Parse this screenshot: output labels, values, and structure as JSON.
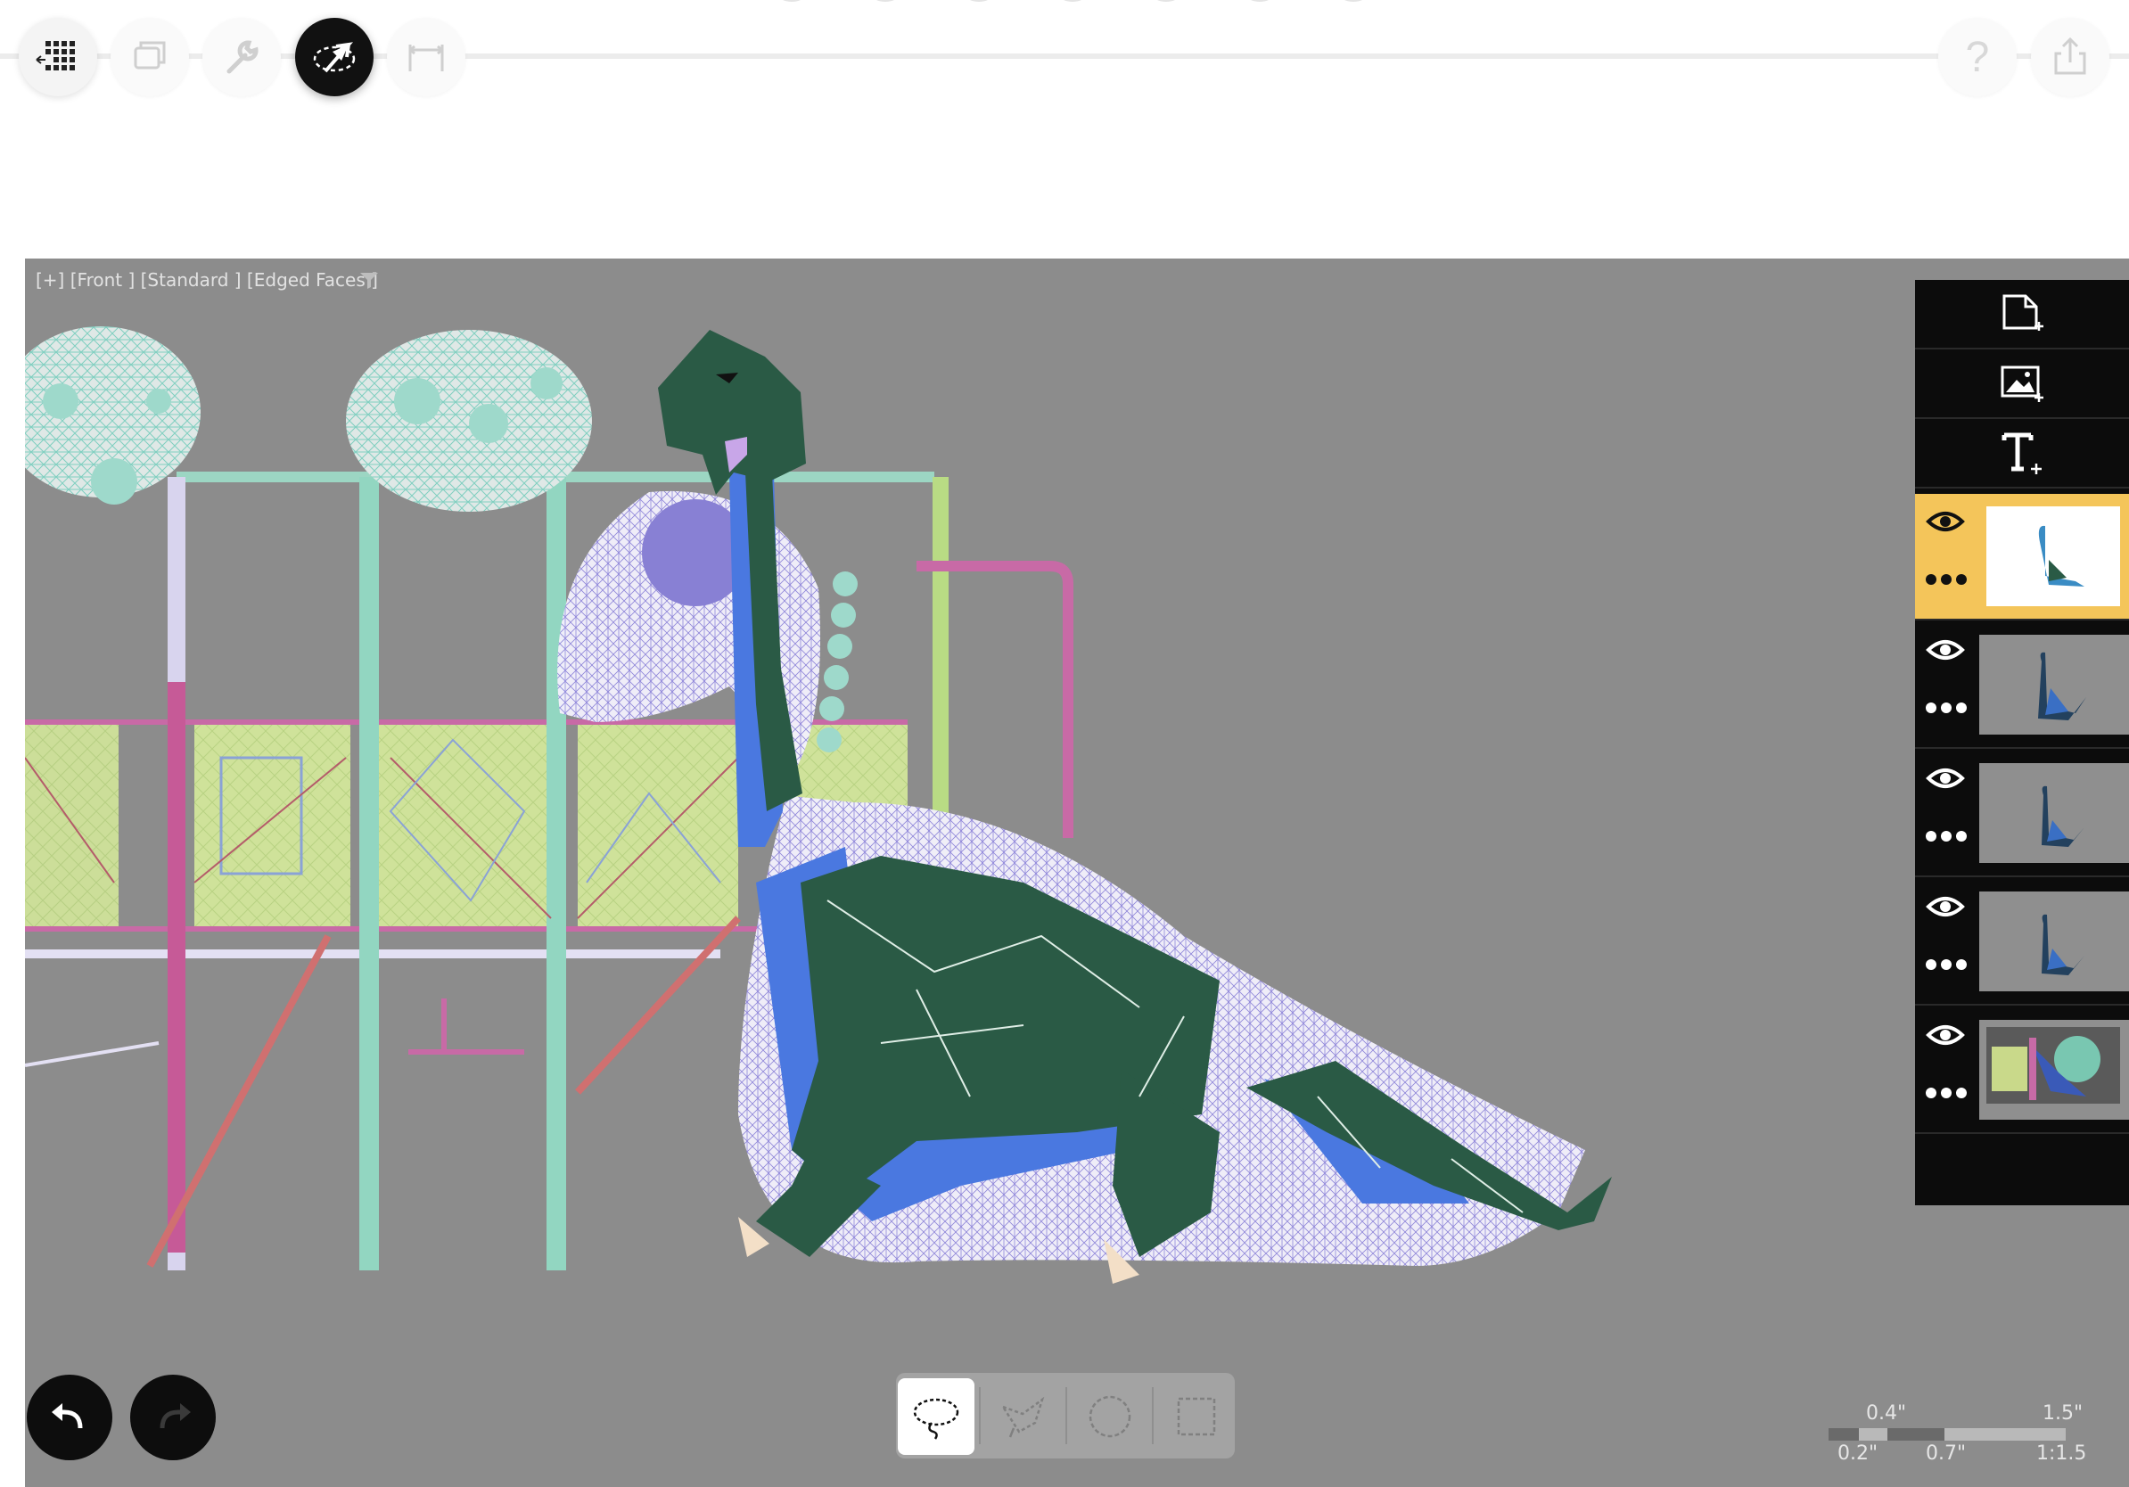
{
  "toolbar": {
    "buttons": [
      {
        "name": "home-grid",
        "icon": "grid-back-icon",
        "state": "normal"
      },
      {
        "name": "windows",
        "icon": "windows-icon",
        "state": "dim"
      },
      {
        "name": "tools",
        "icon": "wrench-icon",
        "state": "dim"
      },
      {
        "name": "select-mode",
        "icon": "selection-arrow-icon",
        "state": "active"
      },
      {
        "name": "measure",
        "icon": "measure-icon",
        "state": "dim"
      },
      {
        "name": "help",
        "icon": "question-icon",
        "state": "dim"
      },
      {
        "name": "share",
        "icon": "share-icon",
        "state": "dim"
      }
    ],
    "help_label": "?"
  },
  "viewport": {
    "label": "[+] [Front ] [Standard ] [Edged Faces ]",
    "filter_icon": "filter-funnel-icon",
    "background": "#8c8c8c"
  },
  "layers_panel": {
    "add_buttons": [
      {
        "name": "new-canvas-layer",
        "icon": "new-page-plus-icon"
      },
      {
        "name": "new-image-layer",
        "icon": "image-plus-icon"
      },
      {
        "name": "new-text-layer",
        "icon": "text-plus-icon"
      }
    ],
    "layers": [
      {
        "thumb": "dino-sketch",
        "active": true,
        "visible": true
      },
      {
        "thumb": "dino-dark",
        "active": false,
        "visible": true
      },
      {
        "thumb": "dino-dark",
        "active": false,
        "visible": true
      },
      {
        "thumb": "dino-dark",
        "active": false,
        "visible": true
      },
      {
        "thumb": "playground-photo",
        "active": false,
        "visible": true
      }
    ],
    "active_color": "#f4c55a"
  },
  "history": {
    "undo_icon": "undo-arrow-icon",
    "redo_icon": "redo-arrow-icon"
  },
  "selection_tools": [
    {
      "name": "lasso",
      "icon": "lasso-icon",
      "active": true
    },
    {
      "name": "polygon-lasso",
      "icon": "polygon-lasso-icon",
      "active": false
    },
    {
      "name": "ellipse",
      "icon": "ellipse-select-icon",
      "active": false
    },
    {
      "name": "rectangle",
      "icon": "rectangle-select-icon",
      "active": false
    }
  ],
  "scale": {
    "top": [
      "0.4\"",
      "1.5\""
    ],
    "bottom": [
      "0.2\"",
      "0.7\"",
      "1:1.5"
    ]
  }
}
